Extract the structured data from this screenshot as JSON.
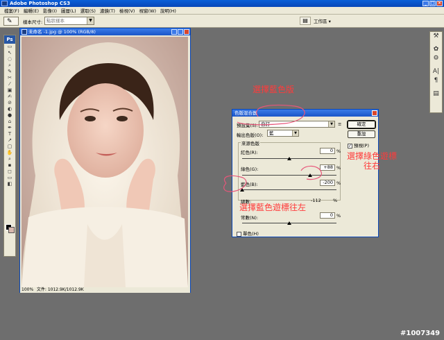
{
  "window": {
    "title": "Adobe Photoshop CS3",
    "buttons": [
      "_",
      "□",
      "×"
    ]
  },
  "menu": [
    "檔案(F)",
    "編輯(E)",
    "影像(I)",
    "圖層(L)",
    "選取(S)",
    "濾鏡(T)",
    "檢視(V)",
    "視窗(W)",
    "說明(H)"
  ],
  "options_bar": {
    "label": "樣本尺寸:",
    "select_value": "點狀樣本",
    "workspace": "工作區 ▾"
  },
  "toolbox": {
    "logo": "Ps",
    "tools": [
      "▭",
      "↖",
      "◌",
      "⌕",
      "✎",
      "✂",
      "⁄",
      "▣",
      "✍",
      "⊘",
      "◐",
      "●",
      "⌂",
      "✒",
      "T",
      "↗",
      "▢",
      "✋",
      "⌕",
      "▪",
      "◻",
      "▭",
      "◧"
    ],
    "fg_color": "#000000",
    "bg_color": "#d7b8ad"
  },
  "right_well": [
    "⚒",
    "✿",
    "⚙",
    "A|",
    "¶",
    "▤"
  ],
  "document": {
    "title": "未命名 -1.jpg @ 100% (RGB/8)",
    "zoom": "100%",
    "file_info": "文件: 1012.9K/1012.9K"
  },
  "dialog": {
    "title": "色版混合器",
    "preset_label": "預設集(S):",
    "preset_value": "自訂",
    "output_label": "輸出色版(O):",
    "output_value": "藍",
    "ok": "確定",
    "cancel": "重設",
    "preview_label": "預視(P)",
    "preview_checked": true,
    "source_group": "來源色版",
    "red_label": "紅色(R):",
    "red_value": "0",
    "green_label": "綠色(G):",
    "green_value": "+88",
    "blue_label": "藍色(B):",
    "blue_value": "-200",
    "total_label": "總數:",
    "total_value": "-112",
    "constant_label": "常數(N):",
    "constant_value": "0",
    "monochrome_label": "單色(H)",
    "monochrome_checked": false,
    "pct": "%",
    "sliders": {
      "red": 0,
      "green": 88,
      "blue": -200,
      "constant": 0
    }
  },
  "annotations": {
    "blue_channel": "選擇藍色版",
    "green_slider": "選擇綠色遊標\n往右",
    "blue_slider": "選擇藍色遊標往左"
  },
  "watermark": "#1007349",
  "colors": {
    "titlebar": "#0a5fd8",
    "annotation": "#ff3b3b",
    "workspace_bg": "#6e6e6e"
  }
}
